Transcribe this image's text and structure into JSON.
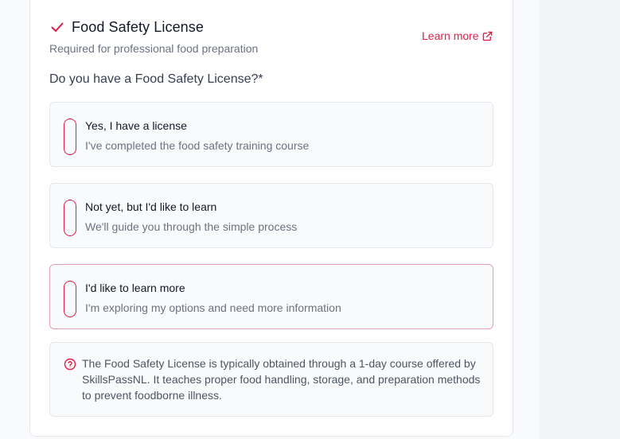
{
  "section": {
    "title": "Food Safety License",
    "subtitle": "Required for professional food preparation",
    "learn_more": "Learn more",
    "question": "Do you have a Food Safety License?*"
  },
  "options": [
    {
      "title": "Yes, I have a license",
      "description": "I've completed the food safety training course",
      "selected": false
    },
    {
      "title": "Not yet, but I'd like to learn",
      "description": "We'll guide you through the simple process",
      "selected": false
    },
    {
      "title": "I'd like to learn more",
      "description": "I'm exploring my options and need more information",
      "selected": true
    }
  ],
  "info": {
    "text": "The Food Safety License is typically obtained through a 1-day course offered by SkillsPassNL. It teaches proper food handling, storage, and preparation methods to prevent foodborne illness."
  },
  "icons": {
    "header": "check-icon",
    "learn_more": "external-link-icon",
    "info": "question-circle-icon"
  },
  "colors": {
    "accent": "#e11d48",
    "selected_border": "#e9a0b3"
  }
}
